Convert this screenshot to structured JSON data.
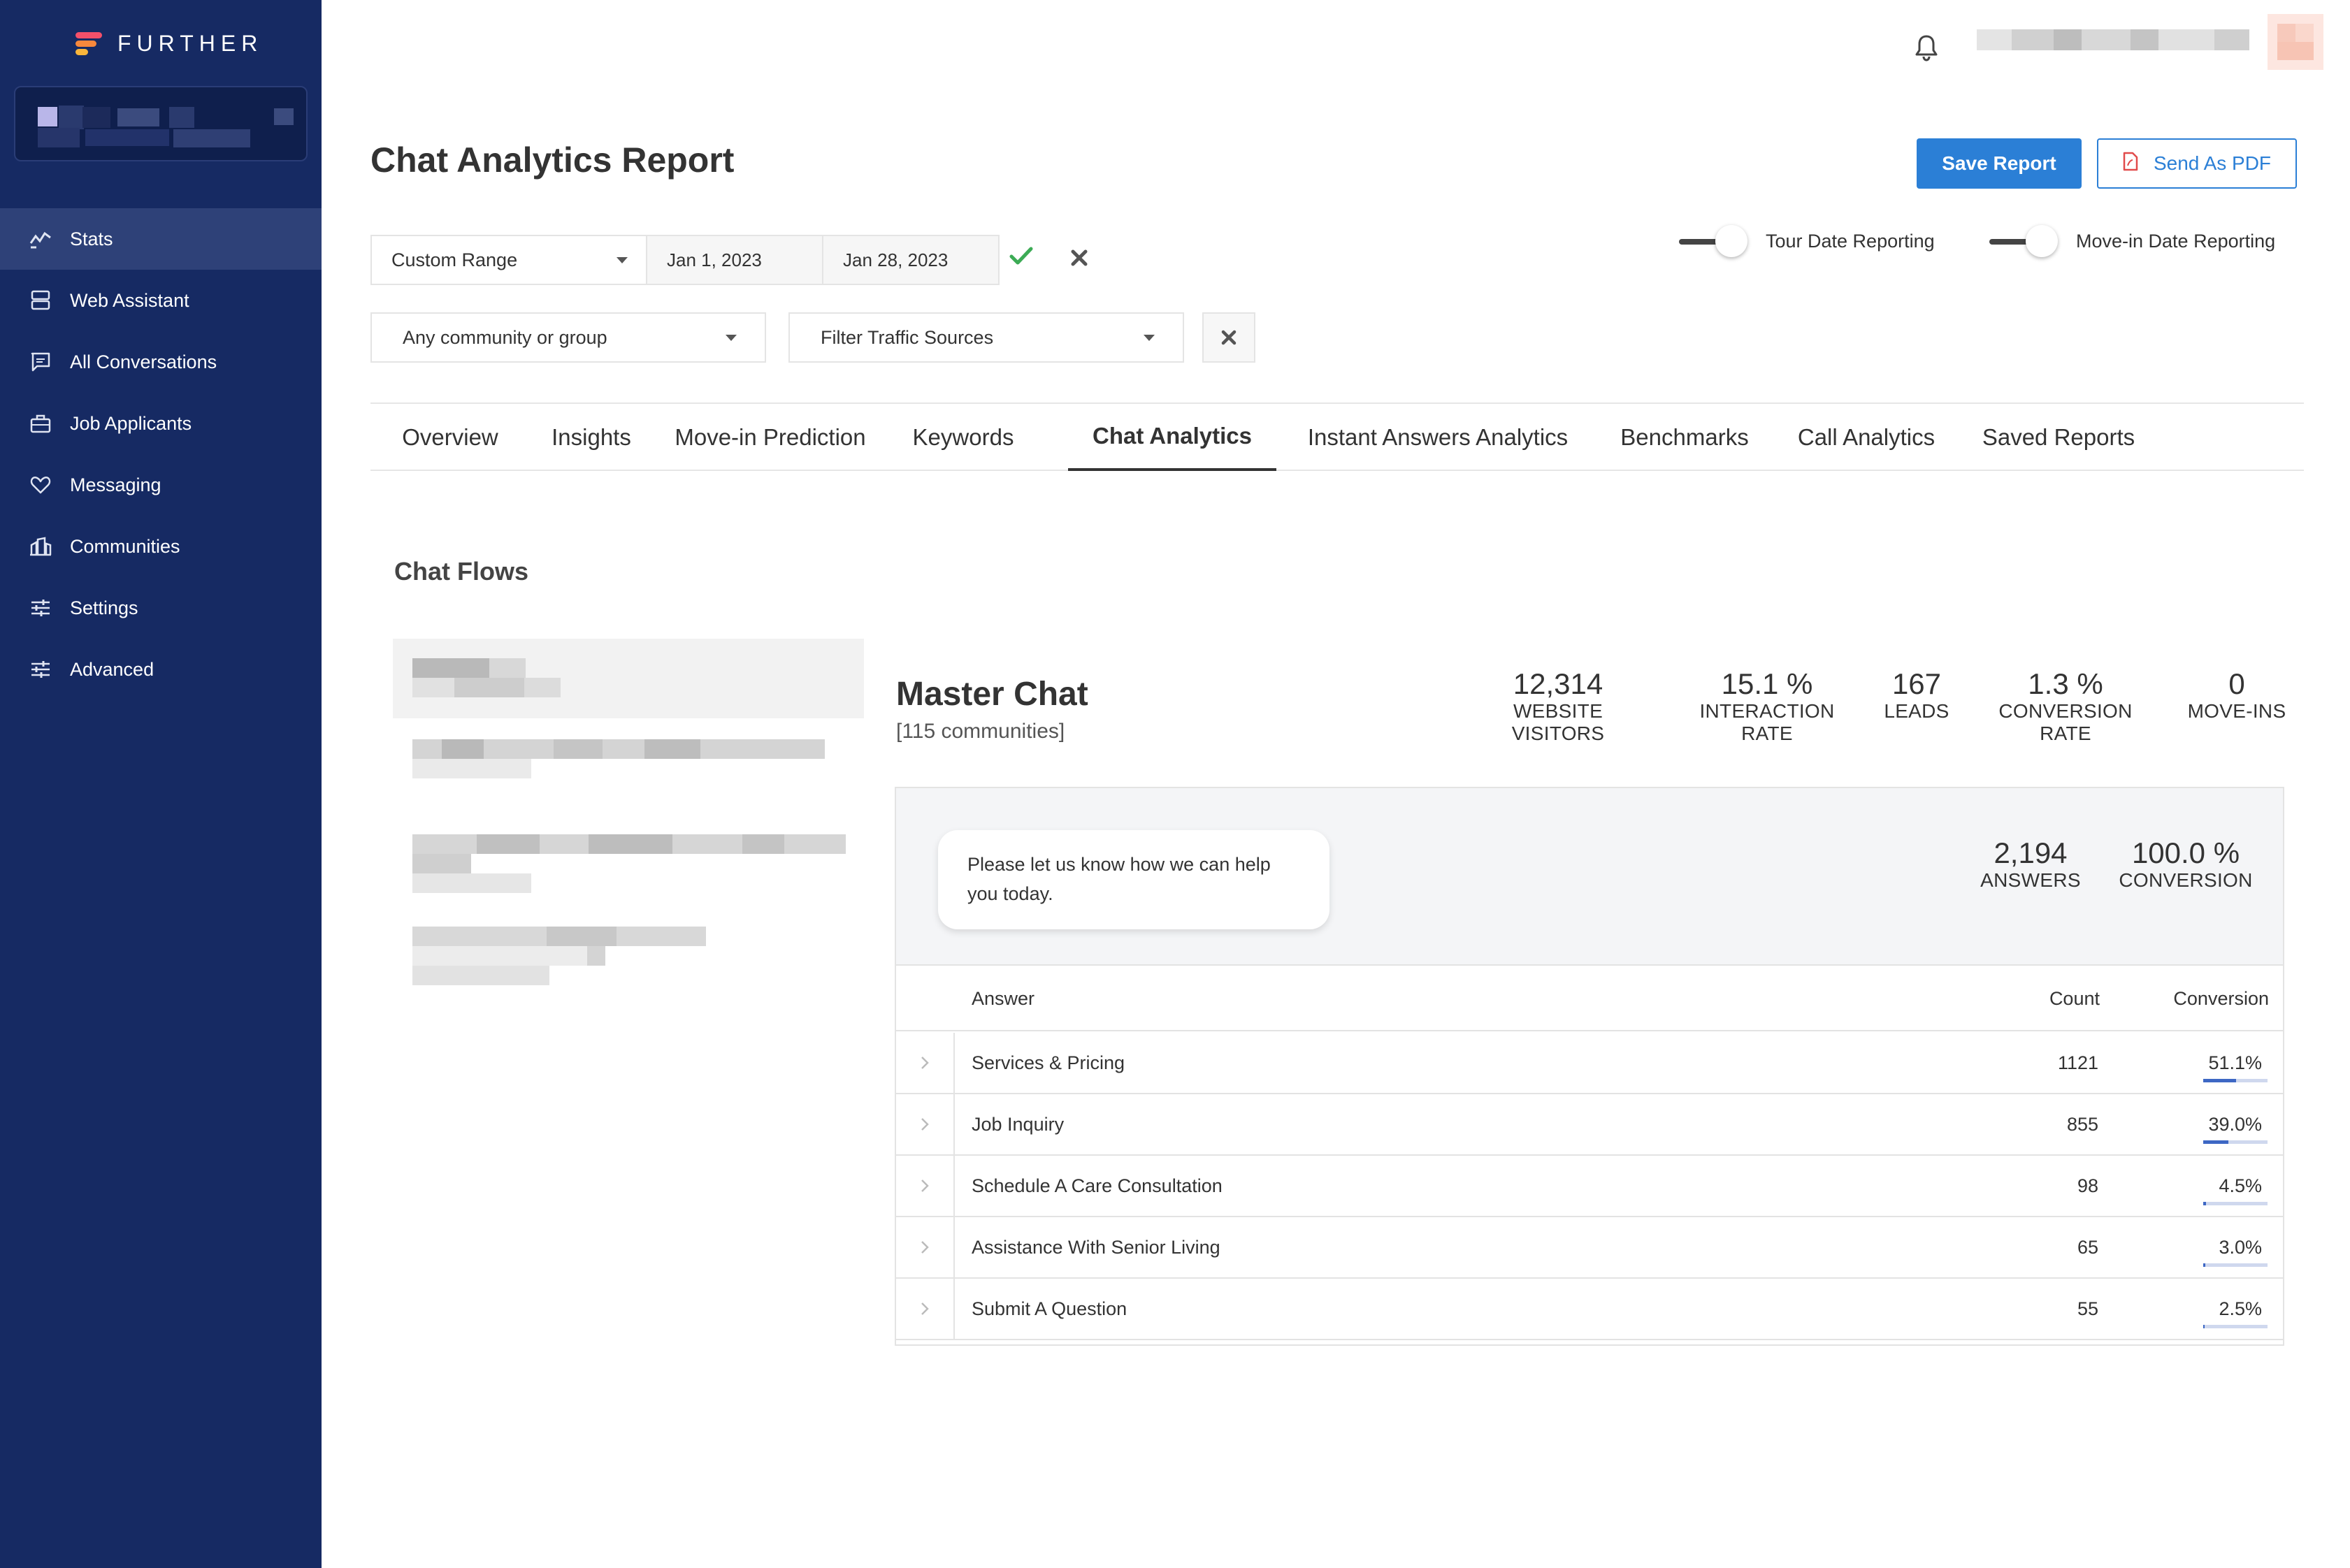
{
  "brand": {
    "name": "FURTHER"
  },
  "sidebar": {
    "items": [
      {
        "label": "Stats",
        "icon": "stats-icon",
        "active": true
      },
      {
        "label": "Web Assistant",
        "icon": "server-icon"
      },
      {
        "label": "All Conversations",
        "icon": "chat-icon"
      },
      {
        "label": "Job Applicants",
        "icon": "briefcase-icon"
      },
      {
        "label": "Messaging",
        "icon": "heart-icon"
      },
      {
        "label": "Communities",
        "icon": "buildings-icon"
      },
      {
        "label": "Settings",
        "icon": "sliders-icon"
      },
      {
        "label": "Advanced",
        "icon": "sliders-icon"
      }
    ]
  },
  "header": {
    "title": "Chat Analytics Report",
    "save_label": "Save Report",
    "pdf_label": "Send As PDF"
  },
  "filters": {
    "range": "Custom Range",
    "start_date": "Jan 1, 2023",
    "end_date": "Jan 28, 2023",
    "community": "Any community or group",
    "traffic": "Filter Traffic Sources",
    "toggle_tour": "Tour Date Reporting",
    "toggle_movein": "Move-in Date Reporting"
  },
  "tabs": [
    {
      "label": "Overview"
    },
    {
      "label": "Insights"
    },
    {
      "label": "Move-in Prediction"
    },
    {
      "label": "Keywords"
    },
    {
      "label": "Chat Analytics",
      "active": true
    },
    {
      "label": "Instant Answers Analytics"
    },
    {
      "label": "Benchmarks"
    },
    {
      "label": "Call Analytics"
    },
    {
      "label": "Saved Reports"
    }
  ],
  "chat_flows": {
    "title": "Chat Flows"
  },
  "master": {
    "title": "Master Chat",
    "subtitle": "[115 communities]",
    "stats": [
      {
        "value": "12,314",
        "label": "WEBSITE VISITORS"
      },
      {
        "value": "15.1 %",
        "label": "INTERACTION RATE"
      },
      {
        "value": "167",
        "label": "LEADS"
      },
      {
        "value": "1.3 %",
        "label": "CONVERSION RATE"
      },
      {
        "value": "0",
        "label": "MOVE-INS"
      }
    ]
  },
  "question": {
    "text": "Please let us know how we can help you today.",
    "answers_value": "2,194",
    "answers_label": "ANSWERS",
    "conversion_value": "100.0 %",
    "conversion_label": "CONVERSION"
  },
  "table": {
    "headers": {
      "answer": "Answer",
      "count": "Count",
      "conversion": "Conversion"
    },
    "rows": [
      {
        "answer": "Services & Pricing",
        "count": "1121",
        "conversion": "51.1%",
        "fraction": 0.511
      },
      {
        "answer": "Job Inquiry",
        "count": "855",
        "conversion": "39.0%",
        "fraction": 0.39
      },
      {
        "answer": "Schedule A Care Consultation",
        "count": "98",
        "conversion": "4.5%",
        "fraction": 0.045
      },
      {
        "answer": "Assistance With Senior Living",
        "count": "65",
        "conversion": "3.0%",
        "fraction": 0.03
      },
      {
        "answer": "Submit A Question",
        "count": "55",
        "conversion": "2.5%",
        "fraction": 0.025
      }
    ]
  },
  "colors": {
    "sidebar": "#162a63",
    "accent": "#2b7fd6",
    "bar": "#3d67c4",
    "check": "#3cab55"
  }
}
